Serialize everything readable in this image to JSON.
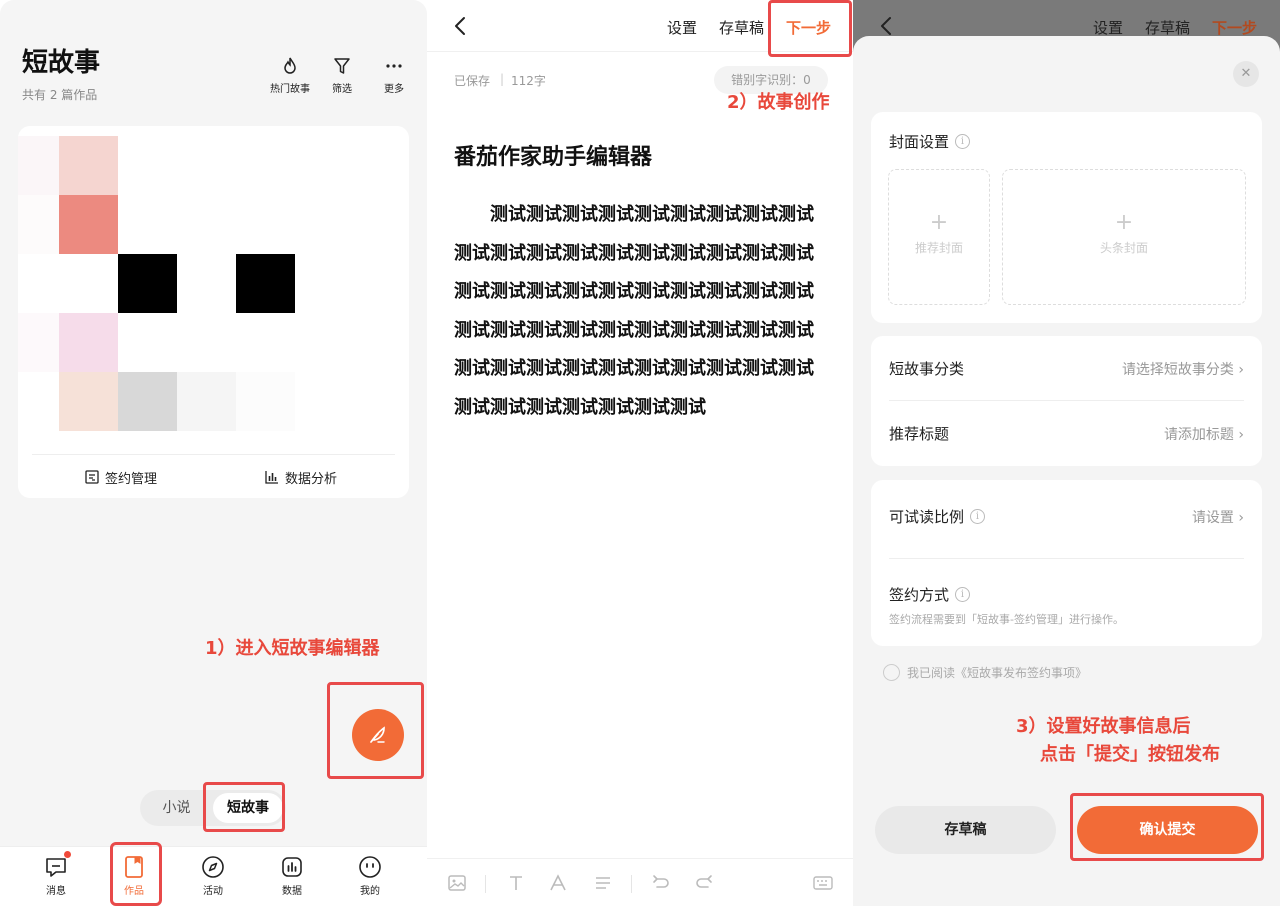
{
  "panel1": {
    "title": "短故事",
    "subtitle": "共有 2 篇作品",
    "actions": [
      {
        "label": "热门故事",
        "icon": "flame-icon"
      },
      {
        "label": "筛选",
        "icon": "filter-icon"
      },
      {
        "label": "更多",
        "icon": "more-icon"
      }
    ],
    "card_buttons": [
      {
        "label": "签约管理",
        "icon": "contract-icon"
      },
      {
        "label": "数据分析",
        "icon": "bar-chart-icon"
      }
    ],
    "annotation": "1）进入短故事编辑器",
    "switch": {
      "novel": "小说",
      "short_story": "短故事"
    },
    "tabs": [
      {
        "label": "消息",
        "icon": "message-icon"
      },
      {
        "label": "作品",
        "icon": "works-icon"
      },
      {
        "label": "活动",
        "icon": "compass-icon"
      },
      {
        "label": "数据",
        "icon": "data-icon"
      },
      {
        "label": "我的",
        "icon": "profile-icon"
      }
    ],
    "colors": {
      "accent": "#f26b37",
      "annotation": "#e8483b"
    }
  },
  "panel2": {
    "nav": {
      "settings": "设置",
      "draft": "存草稿",
      "next": "下一步"
    },
    "saved": "已保存",
    "word_count": "112字",
    "typo_check": "错别字识别：0",
    "annotation": "2）故事创作",
    "doc_title": "番茄作家助手编辑器",
    "doc_body": "测试测试测试测试测试测试测试测试测试测试测试测试测试测试测试测试测试测试测试测试测试测试测试测试测试测试测试测试测试测试测试测试测试测试测试测试测试测试测试测试测试测试测试测试测试测试测试测试测试测试测试测试测试测试测试测试"
  },
  "panel3": {
    "nav": {
      "settings": "设置",
      "draft": "存草稿",
      "next": "下一步"
    },
    "cover_title": "封面设置",
    "cover_recommend": "推荐封面",
    "cover_headline": "头条封面",
    "category_label": "短故事分类",
    "category_value": "请选择短故事分类",
    "title_label": "推荐标题",
    "title_value": "请添加标题",
    "preview_label": "可试读比例",
    "preview_value": "请设置",
    "sign_label": "签约方式",
    "sign_note": "签约流程需要到「短故事-签约管理」进行操作。",
    "agree_text": "我已阅读《短故事发布签约事项》",
    "annotation_line1": "3）设置好故事信息后",
    "annotation_line2": "点击「提交」按钮发布",
    "draft_button": "存草稿",
    "submit_button": "确认提交"
  }
}
